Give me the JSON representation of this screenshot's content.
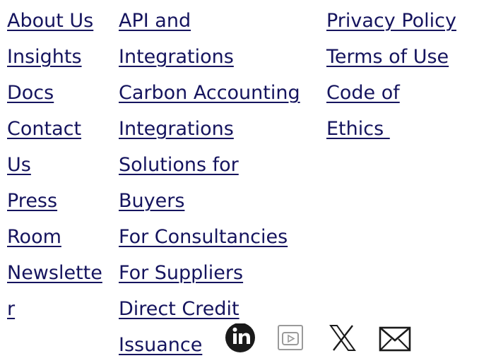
{
  "footer": {
    "company_links": [
      "About Us",
      "Insights",
      "Docs",
      "Contact",
      "Us",
      "Press",
      "Room",
      "Newslette",
      "r"
    ],
    "product_links": [
      "API and",
      "Integrations",
      "Carbon Accounting",
      "Integrations",
      "Solutions for",
      "Buyers",
      "For Consultancies",
      "For Suppliers",
      "Direct Credit",
      "Issuance"
    ],
    "legal_links": [
      "Privacy Policy",
      "Terms of Use",
      "Code of",
      "Ethics "
    ],
    "social_icons": [
      "linkedin-icon",
      "youtube-icon",
      "x-icon",
      "email-icon"
    ],
    "colors": {
      "link": "#15145e",
      "icon_dark": "#1a1a1a",
      "icon_light": "#9a9a9a"
    }
  }
}
